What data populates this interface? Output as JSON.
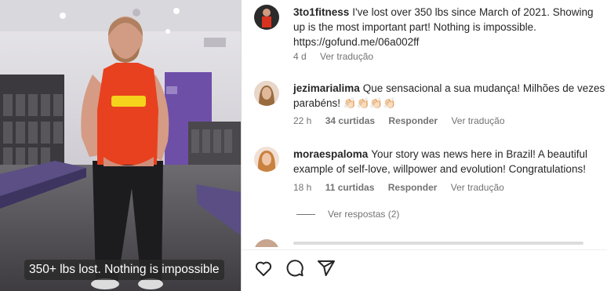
{
  "media": {
    "shirt_text": "HULKAMANIA",
    "caption": "350+ lbs lost. Nothing is impossible"
  },
  "comments": [
    {
      "username": "3to1fitness",
      "text": "I've lost over 350 lbs since March of 2021. Showing up is the most important part! Nothing is impossible. https://gofund.me/06a002ff",
      "time": "4 d",
      "translate": "Ver tradução"
    },
    {
      "username": "jezimarialima",
      "text": "Que sensacional a sua mudança! Milhões de vezes parabéns! 👏🏻👏🏻👏🏻👏🏻",
      "time": "22 h",
      "likes": "34 curtidas",
      "reply": "Responder",
      "translate": "Ver tradução"
    },
    {
      "username": "moraespaloma",
      "text": "Your story was news here in Brazil! A beautiful example of self-love, willpower and evolution! Congratulations!",
      "time": "18 h",
      "likes": "11 curtidas",
      "reply": "Responder",
      "translate": "Ver tradução",
      "view_replies": "Ver respostas (2)"
    }
  ],
  "icons": [
    "heart-icon",
    "comment-icon",
    "share-icon"
  ]
}
